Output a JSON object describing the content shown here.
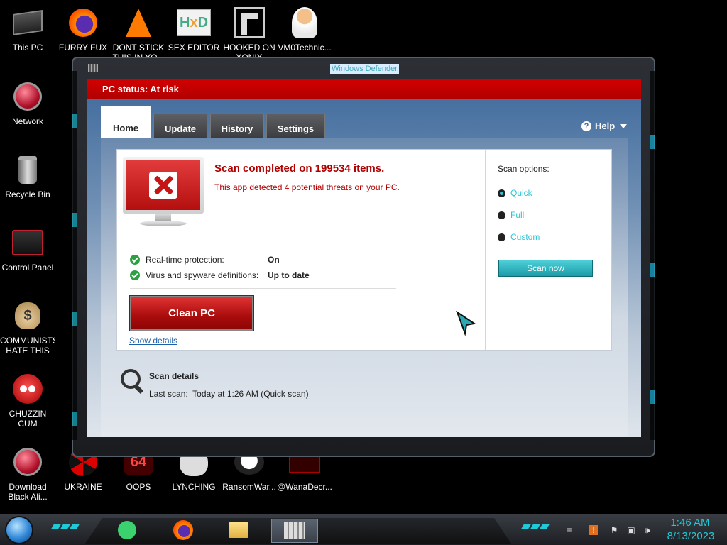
{
  "desktop": {
    "icons": [
      {
        "label": "This PC"
      },
      {
        "label": "FURRY FUX"
      },
      {
        "label": "DONT STICK THIS IN YO..."
      },
      {
        "label": "SEX EDITOR"
      },
      {
        "label": "HOOKED ON XONIX"
      },
      {
        "label": "VM0Technic..."
      },
      {
        "label": "Network"
      },
      {
        "label": "Recycle Bin"
      },
      {
        "label": "Control Panel"
      },
      {
        "label": "COMMUNISTS HATE THIS G..."
      },
      {
        "label": "CHUZZIN CUM"
      },
      {
        "label": "Download Black Ali..."
      },
      {
        "label": "UKRAINE"
      },
      {
        "label": "OOPS"
      },
      {
        "label": "LYNCHING"
      },
      {
        "label": "RansomWar..."
      },
      {
        "label": "@WanaDecr..."
      }
    ]
  },
  "window": {
    "title": "Windows Defender",
    "status": "PC status: At risk",
    "tabs": [
      {
        "label": "Home",
        "active": true
      },
      {
        "label": "Update",
        "active": false
      },
      {
        "label": "History",
        "active": false
      },
      {
        "label": "Settings",
        "active": false
      }
    ],
    "help_label": "Help",
    "help_icon": "question-icon",
    "scan_result": {
      "title": "Scan completed on 199534 items.",
      "subtitle": "This app detected 4 potential threats on your PC."
    },
    "protection": [
      {
        "label": "Real-time protection:",
        "value": "On"
      },
      {
        "label": "Virus and spyware definitions:",
        "value": "Up to date"
      }
    ],
    "clean_button": "Clean PC",
    "show_details": "Show details",
    "scan_options": {
      "title": "Scan options:",
      "options": [
        {
          "label": "Quick",
          "selected": true
        },
        {
          "label": "Full",
          "selected": false
        },
        {
          "label": "Custom",
          "selected": false
        }
      ],
      "scan_now": "Scan now"
    },
    "scan_details": {
      "title": "Scan details",
      "last_scan_label": "Last scan:",
      "last_scan_value": "Today at 1:26 AM (Quick scan)"
    }
  },
  "taskbar": {
    "time": "1:46 AM",
    "date": "8/13/2023"
  },
  "colors": {
    "status_red": "#c00000",
    "accent_cyan": "#1ec9d8",
    "threat_text": "#b00000"
  }
}
